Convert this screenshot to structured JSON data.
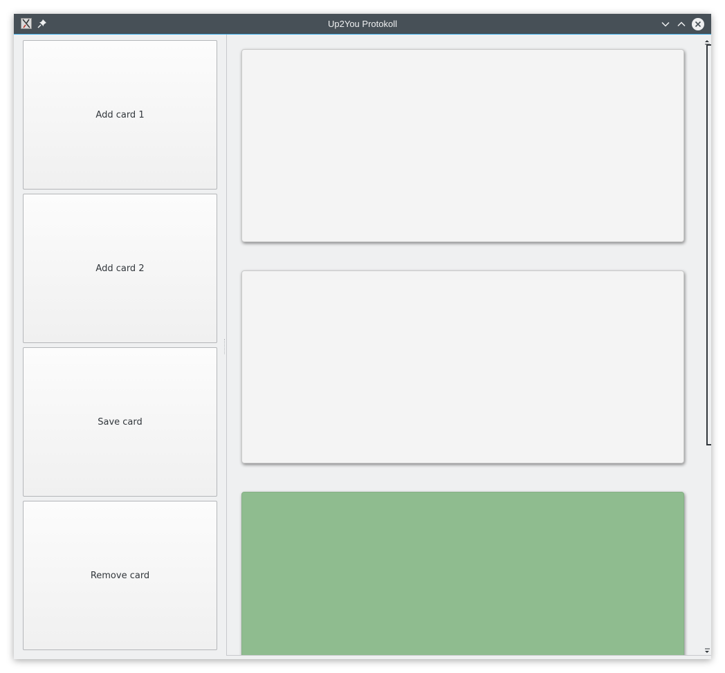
{
  "window": {
    "title": "Up2You Protokoll",
    "app_icon": "app-icon",
    "pin_icon": "pin-icon",
    "minimize_icon": "chevron-down-icon",
    "maximize_icon": "chevron-up-icon",
    "close_icon": "close-icon"
  },
  "sidebar": {
    "buttons": [
      {
        "label": "Add card 1"
      },
      {
        "label": "Add card 2"
      },
      {
        "label": "Save card"
      },
      {
        "label": "Remove card"
      }
    ]
  },
  "cards": [
    {
      "color": "#f4f4f4"
    },
    {
      "color": "#f4f4f4"
    },
    {
      "color": "#8fbc8f"
    }
  ],
  "colors": {
    "titlebar": "#475057",
    "accent": "#3daee9",
    "selected_card": "#8fbc8f",
    "background": "#eff0f1"
  }
}
